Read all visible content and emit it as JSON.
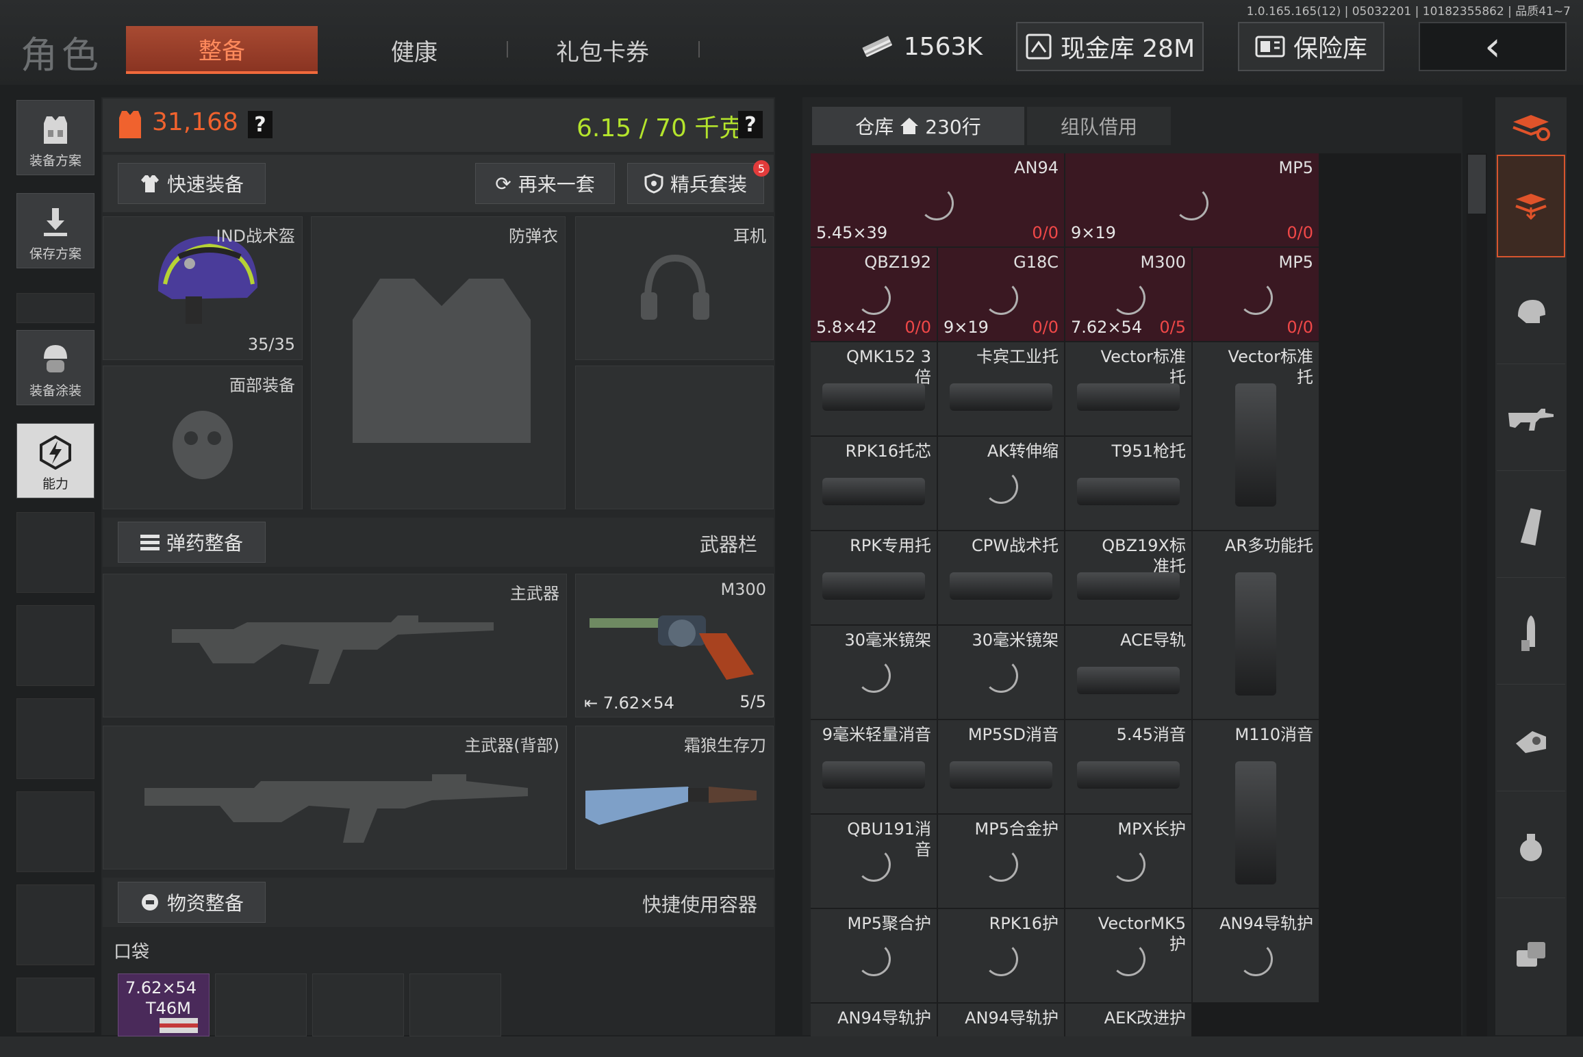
{
  "version": "1.0.165.165(12) | 05032201 | 10182355862 | 品质41~7",
  "header": {
    "role_title": "角色",
    "tabs": [
      "整备",
      "健康",
      "礼包卡券"
    ],
    "money": "1563K",
    "cash_stash": "现金库 28M",
    "safe_box": "保险库",
    "back_icon": "‹"
  },
  "sidebar": [
    "装备方案",
    "保存方案",
    "装备涂装",
    "能力"
  ],
  "equip": {
    "armor_value": "31,168",
    "weight": "6.15 / 70 千克",
    "help": "?",
    "quick_equip": "快速装备",
    "again": "再来一套",
    "elite": "精兵套装",
    "elite_badge": "5",
    "helmet_label": "IND战术盔",
    "helmet_durability": "35/35",
    "vest_label": "防弹衣",
    "headset_label": "耳机",
    "face_label": "面部装备",
    "ammo_prep": "弹药整备",
    "weapon_bar": "武器栏",
    "primary": "主武器",
    "primary_back": "主武器(背部)",
    "sidearm_name": "M300",
    "sidearm_ammo": "7.62×54",
    "sidearm_count": "5/5",
    "melee": "霜狼生存刀",
    "supply_prep": "物资整备",
    "quick_container": "快捷使用容器",
    "pocket": "口袋",
    "pocket_item_line1": "7.62×54",
    "pocket_item_line2": "T46M"
  },
  "inventory": {
    "tab_store": "仓库",
    "tab_store_rows": "230行",
    "tab_team": "组队借用",
    "cells": [
      {
        "name": "AN94",
        "ammo": "5.45×39",
        "count": "0/0",
        "type": "weapon"
      },
      {
        "name": "MP5",
        "ammo": "9×19",
        "count": "0/0",
        "type": "weapon"
      },
      {
        "name": "QBZ192",
        "ammo": "5.8×42",
        "count": "0/0",
        "type": "weapon"
      },
      {
        "name": "G18C",
        "ammo": "9×19",
        "count": "0/0",
        "type": "weapon"
      },
      {
        "name": "M300",
        "ammo": "7.62×54",
        "count": "0/5",
        "type": "weapon"
      },
      {
        "name": "MP5",
        "ammo": "",
        "count": "0/0",
        "type": "weapon"
      },
      {
        "name": "QMK152 3倍",
        "type": "part"
      },
      {
        "name": "卡宾工业托",
        "type": "part"
      },
      {
        "name": "Vector标准托",
        "type": "part"
      },
      {
        "name": "Vector标准托",
        "type": "part"
      },
      {
        "name": "RPK16托芯",
        "type": "part"
      },
      {
        "name": "AK转伸缩",
        "type": "part"
      },
      {
        "name": "T951枪托",
        "type": "part"
      },
      {
        "name": "RPK专用托",
        "type": "part"
      },
      {
        "name": "CPW战术托",
        "type": "part"
      },
      {
        "name": "QBZ19X标准托",
        "type": "part"
      },
      {
        "name": "AR多功能托",
        "type": "part"
      },
      {
        "name": "30毫米镜架",
        "type": "part"
      },
      {
        "name": "30毫米镜架",
        "type": "part"
      },
      {
        "name": "ACE导轨",
        "type": "part"
      },
      {
        "name": "9毫米轻量消音",
        "type": "part"
      },
      {
        "name": "MP5SD消音",
        "type": "part"
      },
      {
        "name": "5.45消音",
        "type": "part"
      },
      {
        "name": "M110消音",
        "type": "part"
      },
      {
        "name": "QBU191消音",
        "type": "part"
      },
      {
        "name": "MP5合金护",
        "type": "part"
      },
      {
        "name": "MPX长护",
        "type": "part"
      },
      {
        "name": "MP5聚合护",
        "type": "part"
      },
      {
        "name": "RPK16护",
        "type": "part"
      },
      {
        "name": "VectorMK5护",
        "type": "part"
      },
      {
        "name": "AN94导轨护",
        "type": "part"
      },
      {
        "name": "AN94导轨护",
        "type": "part"
      },
      {
        "name": "AN94导轨护",
        "type": "part"
      },
      {
        "name": "AEK改进护",
        "type": "part"
      }
    ]
  },
  "colors": {
    "accent": "#f0622e",
    "weight_green": "#b4e42c",
    "weapon_cell": "#3a1822",
    "count_red": "#f04848"
  }
}
